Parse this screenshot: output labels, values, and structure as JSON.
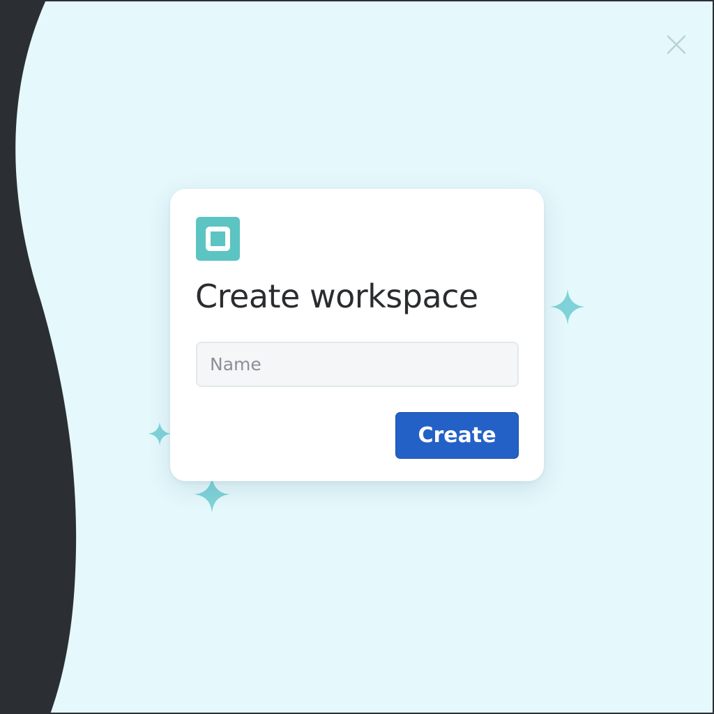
{
  "dialog": {
    "title": "Create workspace",
    "name_placeholder": "Name",
    "name_value": "",
    "create_label": "Create"
  },
  "icons": {
    "app": "workspace-app-icon",
    "close": "close-icon",
    "decoration": "sparkle-icon"
  },
  "colors": {
    "background": "#e5f8fc",
    "sidebar": "#2b2f33",
    "accent": "#5cc4c2",
    "primary_button": "#2461c6",
    "sparkle": "#7fd3d8"
  }
}
